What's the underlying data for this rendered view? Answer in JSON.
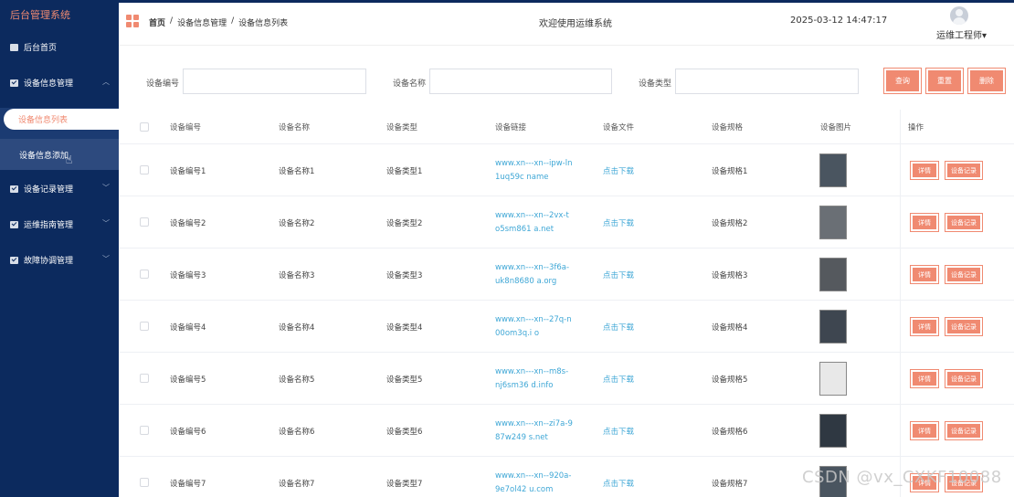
{
  "sidebar": {
    "brand": "后台管理系统",
    "items": [
      {
        "label": "后台首页",
        "icon": "monitor-icon"
      },
      {
        "label": "设备信息管理",
        "icon": "check-icon",
        "expanded": true
      },
      {
        "label": "设备信息列表",
        "active": true
      },
      {
        "label": "设备信息添加"
      },
      {
        "label": "设备记录管理",
        "icon": "check-icon"
      },
      {
        "label": "运维指南管理",
        "icon": "check-icon"
      },
      {
        "label": "故障协调管理",
        "icon": "check-icon"
      }
    ]
  },
  "header": {
    "breadcrumb": [
      "首页",
      "/",
      "设备信息管理",
      "/",
      "设备信息列表"
    ],
    "welcome": "欢迎使用运维系统",
    "datetime": "2025-03-12 14:47:17",
    "user": "运维工程师▾"
  },
  "search": {
    "fields": [
      {
        "label": "设备编号",
        "value": ""
      },
      {
        "label": "设备名称",
        "value": ""
      },
      {
        "label": "设备类型",
        "value": ""
      }
    ],
    "buttons": [
      "查询",
      "重置",
      "删除"
    ]
  },
  "table": {
    "columns": [
      "设备编号",
      "设备名称",
      "设备类型",
      "设备链接",
      "设备文件",
      "设备规格",
      "设备图片",
      "操作"
    ],
    "rows": [
      {
        "no": "设备编号1",
        "name": "设备名称1",
        "type": "设备类型1",
        "link": "www.xn---xn--ipw-ln1uq59c name",
        "file": "点击下载",
        "spec": "设备规格1"
      },
      {
        "no": "设备编号2",
        "name": "设备名称2",
        "type": "设备类型2",
        "link": "www.xn---xn--2vx-to5sm861 a.net",
        "file": "点击下载",
        "spec": "设备规格2"
      },
      {
        "no": "设备编号3",
        "name": "设备名称3",
        "type": "设备类型3",
        "link": "www.xn---xn--3f6a-uk8n8680 a.org",
        "file": "点击下载",
        "spec": "设备规格3"
      },
      {
        "no": "设备编号4",
        "name": "设备名称4",
        "type": "设备类型4",
        "link": "www.xn---xn--27q-n00om3q.i o",
        "file": "点击下载",
        "spec": "设备规格4"
      },
      {
        "no": "设备编号5",
        "name": "设备名称5",
        "type": "设备类型5",
        "link": "www.xn---xn--m8s-nj6sm36 d.info",
        "file": "点击下载",
        "spec": "设备规格5"
      },
      {
        "no": "设备编号6",
        "name": "设备名称6",
        "type": "设备类型6",
        "link": "www.xn---xn--zi7a-987w249 s.net",
        "file": "点击下载",
        "spec": "设备规格6"
      },
      {
        "no": "设备编号7",
        "name": "设备名称7",
        "type": "设备类型7",
        "link": "www.xn---xn--920a-9e7ol42 u.com",
        "file": "点击下载",
        "spec": "设备规格7"
      }
    ],
    "row_actions": [
      "详情",
      "设备记录"
    ]
  },
  "watermark": "CSDN @vx_CXKF10088",
  "colors": {
    "sidebar": "#0c2a5e",
    "accent": "#f08a71",
    "link": "#3fa7d6"
  }
}
